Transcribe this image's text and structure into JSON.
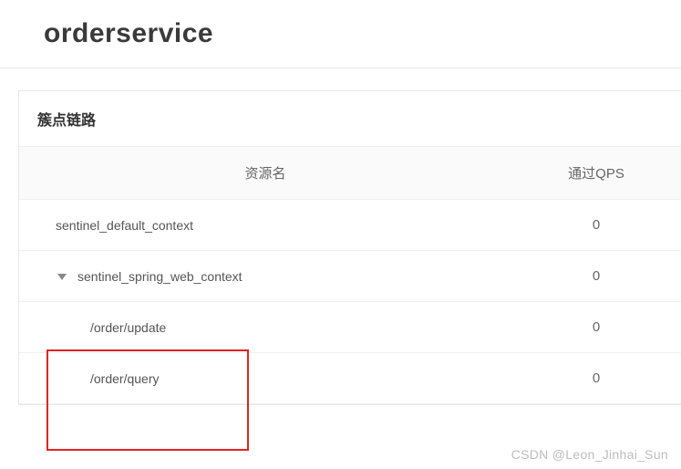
{
  "title": "orderservice",
  "panel": {
    "header": "簇点链路",
    "columns": {
      "name": "资源名",
      "qps": "通过QPS"
    },
    "rows": [
      {
        "name": "sentinel_default_context",
        "qps": "0",
        "indent": 1,
        "expand": false
      },
      {
        "name": "sentinel_spring_web_context",
        "qps": "0",
        "indent": 1,
        "expand": true
      },
      {
        "name": "/order/update",
        "qps": "0",
        "indent": 2,
        "expand": false
      },
      {
        "name": "/order/query",
        "qps": "0",
        "indent": 2,
        "expand": false
      }
    ]
  },
  "watermark": "CSDN @Leon_Jinhai_Sun"
}
